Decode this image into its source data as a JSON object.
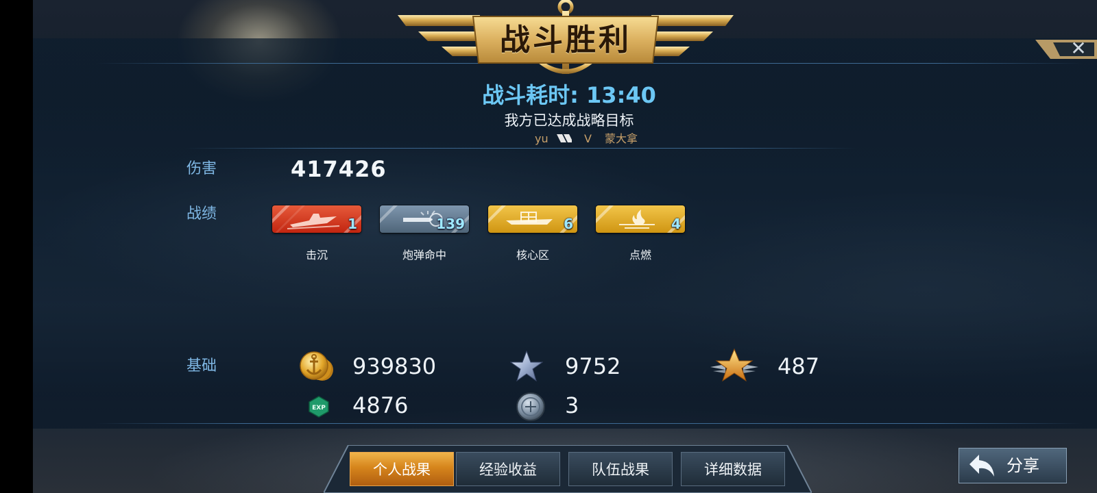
{
  "header": {
    "title": "战斗胜利",
    "battle_time": "战斗耗时: 13:40",
    "objective": "我方已达成战略目标",
    "player_left": "yu",
    "vs": "V",
    "player_right": "蒙大拿"
  },
  "close": {
    "symbol": "✕"
  },
  "damage": {
    "label": "伤害",
    "value": "417426"
  },
  "record": {
    "label": "战绩",
    "badges": [
      {
        "name": "击沉",
        "count": "1",
        "color": "#d83a1e",
        "icon": "sinking-ship-icon"
      },
      {
        "name": "炮弹命中",
        "count": "139",
        "color": "#6a8196",
        "icon": "shell-hit-icon"
      },
      {
        "name": "核心区",
        "count": "6",
        "color": "#e0ad2e",
        "icon": "core-zone-icon"
      },
      {
        "name": "点燃",
        "count": "4",
        "color": "#e0ad2e",
        "icon": "fire-icon"
      }
    ]
  },
  "base": {
    "label": "基础",
    "coins": {
      "icon": "gold-coin-icon",
      "value": "939830"
    },
    "silver_star": {
      "icon": "silver-star-icon",
      "value": "9752"
    },
    "gold_star": {
      "icon": "winged-gold-star-icon",
      "value": "487"
    },
    "exp": {
      "icon": "exp-icon",
      "value": "4876"
    },
    "token": {
      "icon": "steel-medal-icon",
      "value": "3"
    }
  },
  "tabs": [
    {
      "label": "个人战果",
      "active": true
    },
    {
      "label": "经验收益",
      "active": false
    },
    {
      "label": "队伍战果",
      "active": false
    },
    {
      "label": "详细数据",
      "active": false
    }
  ],
  "share": {
    "label": "分享",
    "icon": "share-arrow-icon"
  },
  "colors": {
    "accent_blue": "#6cc7f4",
    "label_blue": "#7fb7e4",
    "gold": "#d6a94a",
    "active_tab": "#e8961e"
  }
}
